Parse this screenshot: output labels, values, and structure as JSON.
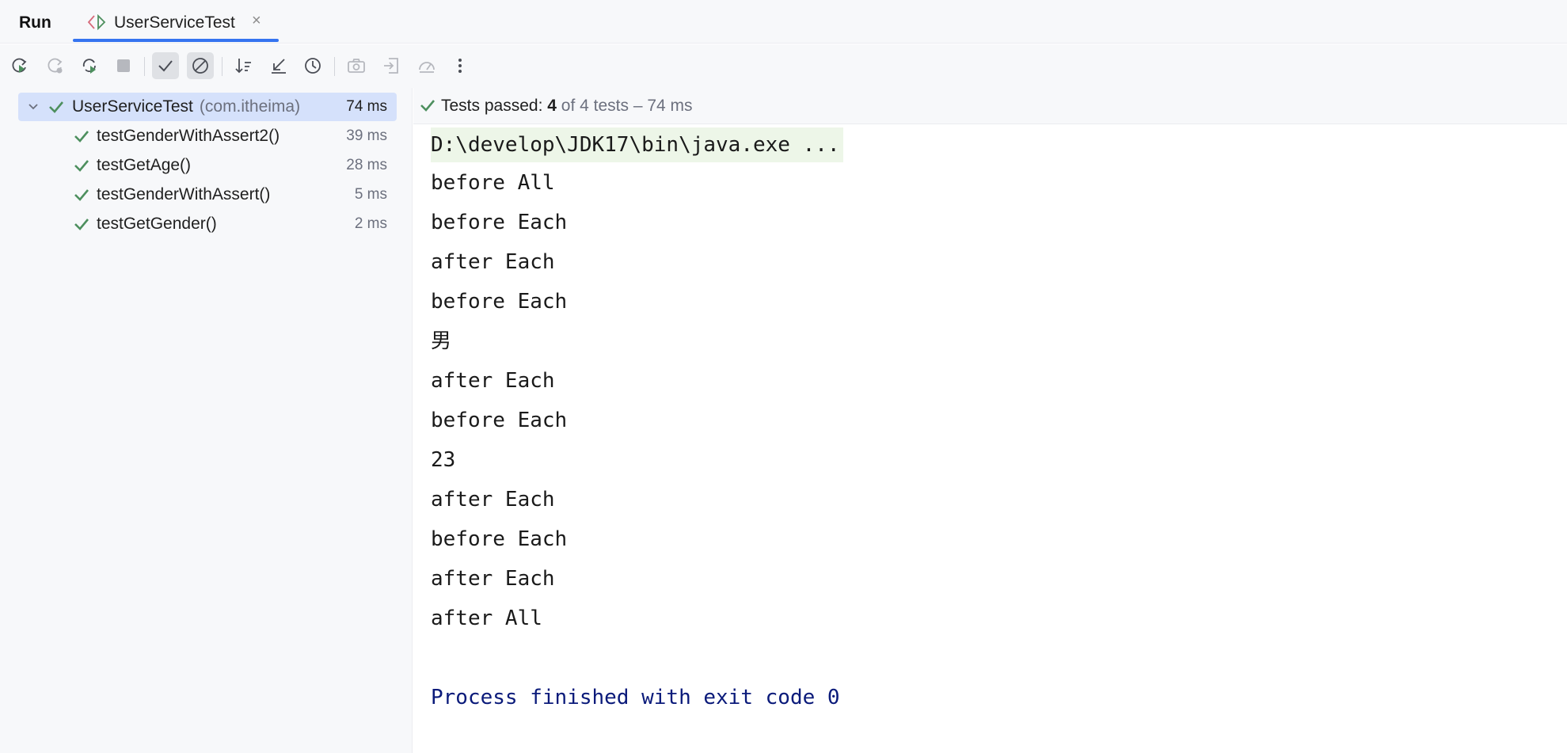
{
  "panel": {
    "title": "Run"
  },
  "tab": {
    "label": "UserServiceTest",
    "close": "×",
    "icon": "test-class-icon"
  },
  "toolbar": {
    "buttons": [
      {
        "name": "rerun-icon"
      },
      {
        "name": "rerun-failed-icon"
      },
      {
        "name": "toggle-auto-test-icon"
      },
      {
        "name": "stop-icon"
      },
      {
        "name": "show-passed-icon",
        "toggled": true
      },
      {
        "name": "show-ignored-icon",
        "toggled": true
      },
      {
        "name": "sort-alphabetically-icon"
      },
      {
        "name": "collapse-all-icon"
      },
      {
        "name": "test-history-icon"
      },
      {
        "name": "screenshot-icon"
      },
      {
        "name": "import-tests-icon"
      },
      {
        "name": "coverage-icon"
      },
      {
        "name": "more-options-icon"
      }
    ]
  },
  "tree": {
    "root": {
      "label": "UserServiceTest",
      "package": "(com.itheima)",
      "time": "74 ms"
    },
    "children": [
      {
        "label": "testGenderWithAssert2()",
        "time": "39 ms"
      },
      {
        "label": "testGetAge()",
        "time": "28 ms"
      },
      {
        "label": "testGenderWithAssert()",
        "time": "5 ms"
      },
      {
        "label": "testGetGender()",
        "time": "2 ms"
      }
    ]
  },
  "status": {
    "prefix": "Tests passed:",
    "count": "4",
    "suffix": "of 4 tests – 74 ms"
  },
  "console": {
    "lines": [
      "D:\\develop\\JDK17\\bin\\java.exe ...",
      "before All",
      "before Each",
      "after Each",
      "before Each",
      "男",
      "after Each",
      "before Each",
      "23",
      "after Each",
      "before Each",
      "after Each",
      "after All"
    ],
    "exit": "Process finished with exit code 0"
  },
  "colors": {
    "accent": "#3574f0",
    "success": "#4d8f5e",
    "exit_text": "#0a1a7a",
    "selection": "#d5e1fb"
  }
}
